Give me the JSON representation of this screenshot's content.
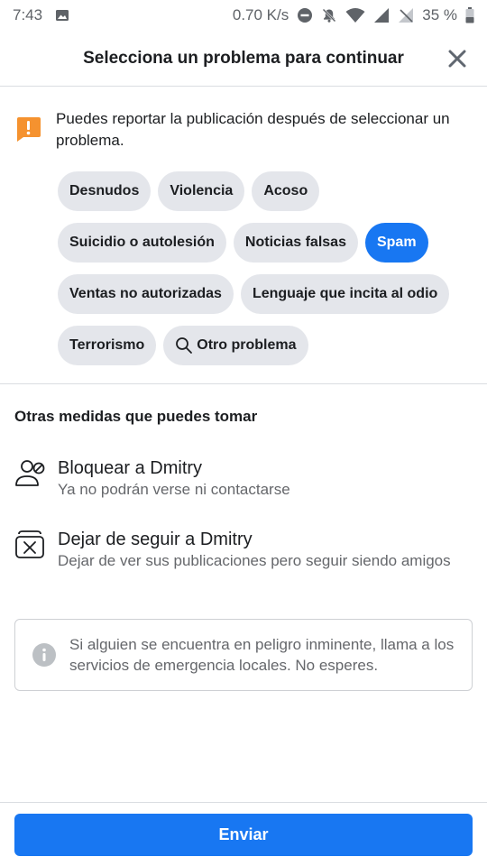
{
  "status_bar": {
    "time": "7:43",
    "speed": "0.70 K/s",
    "battery": "35 %"
  },
  "header": {
    "title": "Selecciona un problema para continuar"
  },
  "notice": {
    "text": "Puedes reportar la publicación después de seleccionar un problema."
  },
  "chips": {
    "row1": [
      "Desnudos",
      "Violencia",
      "Acoso"
    ],
    "row2": [
      "Suicidio o autolesión",
      "Noticias falsas",
      "Spam"
    ],
    "row3": [
      "Ventas no autorizadas",
      "Lenguaje que incita al odio"
    ],
    "row4": [
      "Terrorismo",
      "Otro problema"
    ],
    "selected": "Spam"
  },
  "other_actions": {
    "title": "Otras medidas que puedes tomar",
    "block": {
      "title": "Bloquear a Dmitry",
      "subtitle": "Ya no podrán verse ni contactarse"
    },
    "unfollow": {
      "title": "Dejar de seguir a Dmitry",
      "subtitle": "Dejar de ver sus publicaciones pero seguir siendo amigos"
    }
  },
  "info": {
    "text": "Si alguien se encuentra en peligro inminente, llama a los servicios de emergencia locales. No esperes."
  },
  "footer": {
    "submit_label": "Enviar"
  },
  "colors": {
    "primary": "#1877f2",
    "chip_bg": "#e4e6eb",
    "warning": "#f5922f"
  },
  "icons": {
    "status": [
      "image-icon",
      "dnd-icon",
      "mute-icon",
      "wifi-icon",
      "signal-icon",
      "no-signal-icon",
      "battery-icon"
    ],
    "close": "close-icon",
    "warning": "warning-icon",
    "search": "search-icon",
    "block": "block-user-icon",
    "unfollow": "unfollow-icon",
    "info": "info-icon"
  }
}
